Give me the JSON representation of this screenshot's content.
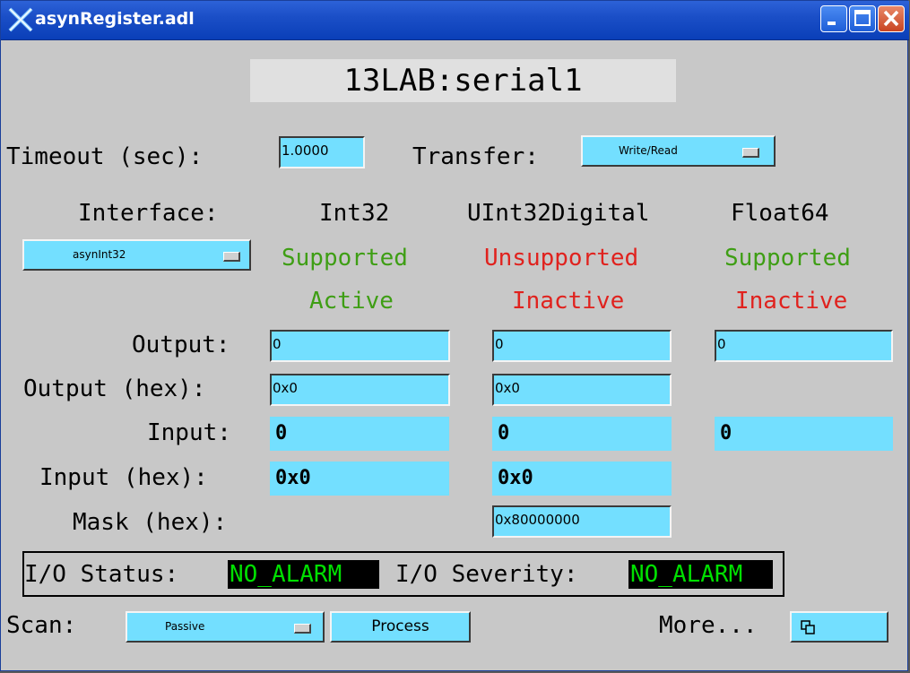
{
  "window": {
    "title": "asynRegister.adl"
  },
  "header": {
    "port_name": "13LAB:serial1"
  },
  "timeout": {
    "label": "Timeout (sec):",
    "value": "1.0000"
  },
  "transfer": {
    "label": "Transfer:",
    "value": "Write/Read"
  },
  "interface": {
    "label": "Interface:",
    "menu_value": "asynInt32",
    "columns": [
      {
        "name": "Int32",
        "support": "Supported",
        "status": "Active"
      },
      {
        "name": "UInt32Digital",
        "support": "Unsupported",
        "status": "Inactive"
      },
      {
        "name": "Float64",
        "support": "Supported",
        "status": "Inactive"
      }
    ]
  },
  "rows": {
    "output_label": "Output:",
    "output_hex_label": "Output (hex):",
    "input_label": "Input:",
    "input_hex_label": "Input (hex):",
    "mask_hex_label": "Mask (hex):"
  },
  "int32": {
    "output": "0",
    "output_hex": "0x0",
    "input": "0",
    "input_hex": "0x0"
  },
  "uint32": {
    "output": "0",
    "output_hex": "0x0",
    "input": "0",
    "input_hex": "0x0",
    "mask_hex": "0x80000000"
  },
  "float64": {
    "output": "0",
    "input": "0"
  },
  "io": {
    "status_label": "I/O Status:",
    "status_value": "NO_ALARM",
    "severity_label": "I/O Severity:",
    "severity_value": "NO_ALARM"
  },
  "scan": {
    "label": "Scan:",
    "value": "Passive"
  },
  "process_button": "Process",
  "more_label": "More...",
  "colors": {
    "background": "#c8c8c8",
    "field": "#73dfff",
    "supported": "#3e9e14",
    "unsupported": "#e0221e",
    "alarm_bg": "#000000",
    "alarm_text": "#00e000"
  }
}
